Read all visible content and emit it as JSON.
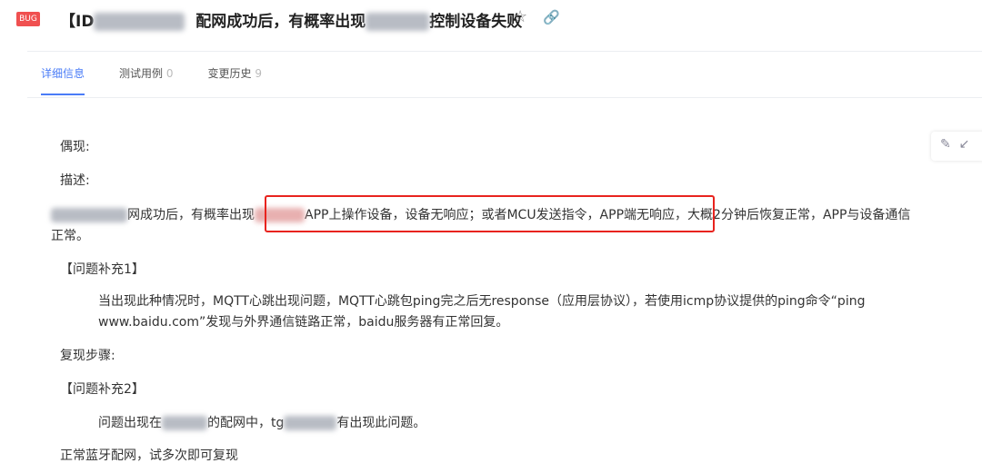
{
  "header": {
    "badge": "BUG",
    "title_prefix": "【ID",
    "title_mid": "配网成功后，有概率出现",
    "title_suffix": "控制设备失败"
  },
  "tabs": [
    {
      "label": "详细信息",
      "count": ""
    },
    {
      "label": "测试用例",
      "count": "0"
    },
    {
      "label": "变更历史",
      "count": "9"
    }
  ],
  "content": {
    "l1": "偶现:",
    "l2": "描述:",
    "p1a": "网成功后，有概率出现",
    "p1b": "APP上操作设备，设备无响应；或者MCU发送指令，APP端无响应，",
    "p1c": "大概2分钟后恢复正常，APP与设备通信",
    "p1d": "正常。",
    "s1": "【问题补充1】",
    "s1a": "当出现此种情况时，MQTT心跳出现问题，MQTT心跳包ping完之后无response（应用层协议），若使用icmp协议提供的ping命令“ping",
    "s1b": "www.baidu.com”发现与外界通信链路正常，baidu服务器有正常回复。",
    "l3": "复现步骤:",
    "s2": "【问题补充2】",
    "s2a": "问题出现在",
    "s2b": "的配网中，tg",
    "s2c": "有出现此问题。",
    "l4": "正常蓝牙配网，试多次即可复现"
  }
}
